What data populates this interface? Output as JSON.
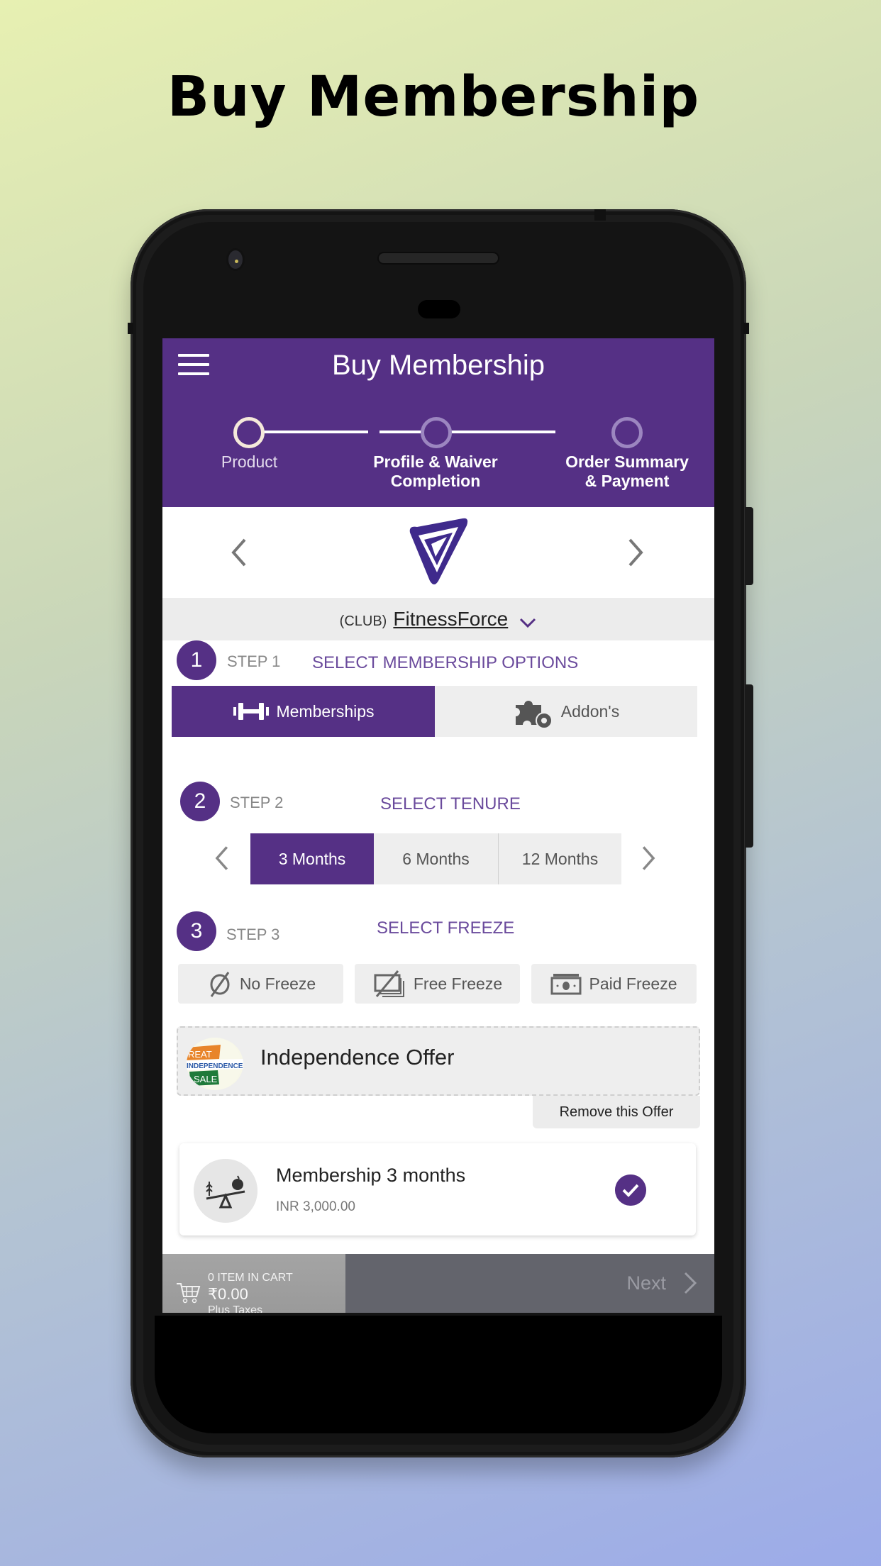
{
  "promo": {
    "title": "Buy Membership"
  },
  "app": {
    "title": "Buy Membership",
    "menu_icon": "hamburger-menu-icon",
    "brand_color": "#553085"
  },
  "stepper": {
    "steps": [
      {
        "label": "Product",
        "state": "active"
      },
      {
        "label": "Profile & Waiver Completion",
        "line1": "Profile & Waiver",
        "line2": "Completion",
        "state": "pending"
      },
      {
        "label": "Order Summary & Payment",
        "line1": "Order Summary",
        "line2": "& Payment",
        "state": "pending"
      }
    ]
  },
  "club": {
    "tag": "(CLUB)",
    "name": "FitnessForce",
    "logo_icon": "fitnessforce-logo-icon",
    "prev_icon": "chevron-left-icon",
    "next_icon": "chevron-right-icon"
  },
  "step1": {
    "number": "1",
    "label": "STEP 1",
    "title": "SELECT MEMBERSHIP OPTIONS",
    "options": [
      {
        "label": "Memberships",
        "icon": "dumbbell-icon",
        "selected": true
      },
      {
        "label": "Addon's",
        "icon": "puzzle-gear-icon",
        "selected": false
      }
    ]
  },
  "step2": {
    "number": "2",
    "label": "STEP 2",
    "title": "SELECT TENURE",
    "options": [
      {
        "label": "3 Months",
        "selected": true
      },
      {
        "label": "6 Months",
        "selected": false
      },
      {
        "label": "12 Months",
        "selected": false
      }
    ]
  },
  "step3": {
    "number": "3",
    "label": "STEP 3",
    "title": "SELECT FREEZE",
    "options": [
      {
        "label": "No Freeze",
        "icon": "empty-set-icon"
      },
      {
        "label": "Free Freeze",
        "icon": "cash-crossed-icon"
      },
      {
        "label": "Paid Freeze",
        "icon": "cash-icon"
      }
    ]
  },
  "offer": {
    "title": "Independence Offer",
    "badge_text": [
      "REAT",
      "INDEPENDENCE",
      "SALE"
    ],
    "remove_label": "Remove this Offer"
  },
  "product": {
    "name": "Membership 3 months",
    "price": "INR 3,000.00",
    "selected": true
  },
  "cart": {
    "count_label": "0 ITEM IN CART",
    "total": "₹0.00",
    "tax_note": "Plus Taxes"
  },
  "next": {
    "label": "Next"
  }
}
